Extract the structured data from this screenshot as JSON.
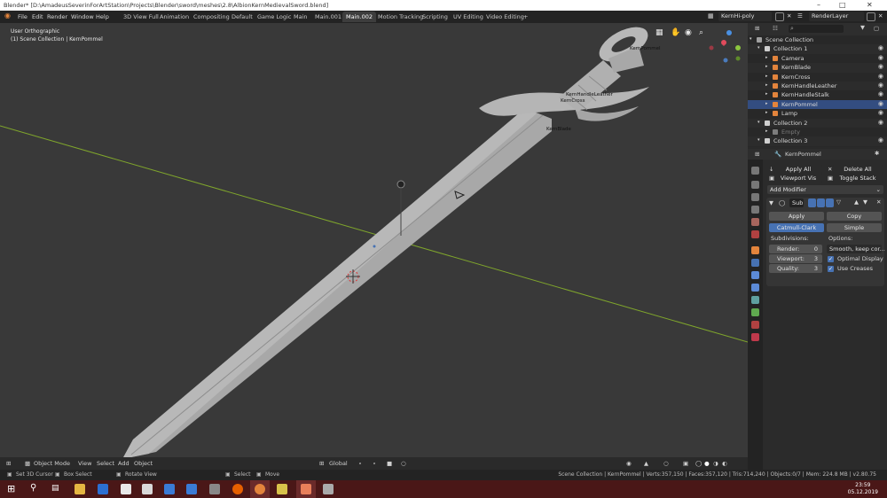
{
  "window": {
    "title": "Blender* [D:\\AmadeusSeverinForArtStation\\Projects\\Blender\\sword\\meshes\\2.8\\AlbionKernMedievalSword.blend]"
  },
  "menu": {
    "file": "File",
    "edit": "Edit",
    "render": "Render",
    "window": "Window",
    "help": "Help"
  },
  "workspaces": [
    {
      "label": "3D View Full",
      "active": false
    },
    {
      "label": "Animation",
      "active": false
    },
    {
      "label": "Compositing",
      "active": false
    },
    {
      "label": "Default",
      "active": false
    },
    {
      "label": "Game Logic",
      "active": false
    },
    {
      "label": "Main",
      "active": false
    },
    {
      "label": "Main.001",
      "active": false
    },
    {
      "label": "Main.002",
      "active": true
    },
    {
      "label": "Motion Tracking",
      "active": false
    },
    {
      "label": "Scripting",
      "active": false
    },
    {
      "label": "UV Editing",
      "active": false
    },
    {
      "label": "Video Editing",
      "active": false
    }
  ],
  "add_workspace": "+",
  "scene": {
    "name": "KernHi-poly",
    "view_layer": "RenderLayer"
  },
  "viewport": {
    "view_name": "User Orthographic",
    "context": "(1) Scene Collection | KernPommel",
    "labels": {
      "pommel": "KernPommel",
      "handle_leather": "KernHandleLeather",
      "cross": "KernCross",
      "blade": "KernBlade"
    },
    "gizmo_axes": {
      "x": "X",
      "y": "Y",
      "z": "Z"
    }
  },
  "viewport_header": {
    "mode": "Object Mode",
    "view": "View",
    "select": "Select",
    "add": "Add",
    "object": "Object",
    "orientation": "Global"
  },
  "outliner": {
    "search_placeholder": "",
    "rows": [
      {
        "label": "Scene Collection",
        "indent": 0,
        "icon": "scene-collection-icon",
        "color": "#a0a0a0",
        "eye": false
      },
      {
        "label": "Collection 1",
        "indent": 1,
        "icon": "collection-icon",
        "color": "#cfcfcf",
        "eye": true
      },
      {
        "label": "Camera",
        "indent": 2,
        "icon": "camera-icon",
        "color": "#e3843c",
        "eye": true
      },
      {
        "label": "KernBlade",
        "indent": 2,
        "icon": "mesh-object-icon",
        "color": "#e3843c",
        "eye": true
      },
      {
        "label": "KernCross",
        "indent": 2,
        "icon": "mesh-object-icon",
        "color": "#e3843c",
        "eye": true
      },
      {
        "label": "KernHandleLeather",
        "indent": 2,
        "icon": "mesh-object-icon",
        "color": "#e3843c",
        "eye": true
      },
      {
        "label": "KernHandleStalk",
        "indent": 2,
        "icon": "mesh-object-icon",
        "color": "#e3843c",
        "eye": true
      },
      {
        "label": "KernPommel",
        "indent": 2,
        "icon": "mesh-object-icon",
        "color": "#e3843c",
        "eye": true,
        "selected": true
      },
      {
        "label": "Lamp",
        "indent": 2,
        "icon": "light-icon",
        "color": "#e3843c",
        "eye": true
      },
      {
        "label": "Collection 2",
        "indent": 1,
        "icon": "collection-icon",
        "color": "#cfcfcf",
        "eye": true
      },
      {
        "label": "Empty",
        "indent": 2,
        "icon": "empty-icon",
        "color": "#7d7d7d",
        "eye": false
      },
      {
        "label": "Collection 3",
        "indent": 1,
        "icon": "collection-icon",
        "color": "#cfcfcf",
        "eye": true
      }
    ]
  },
  "properties": {
    "object_name": "KernPommel",
    "apply_all": "Apply All",
    "delete_all": "Delete All",
    "viewport_vis": "Viewport Vis",
    "toggle_stack": "Toggle Stack",
    "add_modifier": "Add Modifier",
    "modifier_name": "Sub",
    "apply": "Apply",
    "copy": "Copy",
    "catmull_clark": "Catmull-Clark",
    "simple": "Simple",
    "subdivisions_label": "Subdivisions:",
    "options_label": "Options:",
    "render_label": "Render:",
    "render_value": "0",
    "viewport_label": "Viewport:",
    "viewport_value": "3",
    "quality_label": "Quality:",
    "quality_value": "3",
    "uv_smooth": "Smooth, keep cor...",
    "optimal_display": "Optimal Display",
    "use_creases": "Use Creases"
  },
  "statusbar": {
    "set_cursor": "Set 3D Cursor",
    "box_select": "Box Select",
    "rotate_view": "Rotate View",
    "select": "Select",
    "move": "Move",
    "stats": "Scene Collection | KernPommel | Verts:357,150 | Faces:357,120 | Tris:714,240 | Objects:0/7 | Mem: 224.8 MB | v2.80.75"
  },
  "taskbar": {
    "time": "23:59",
    "date": "05.12.2019"
  },
  "colors": {
    "accent": "#4772b3",
    "viewport_bg": "#393939",
    "x_axis": "#8cb531",
    "taskbar": "#4a1717"
  }
}
